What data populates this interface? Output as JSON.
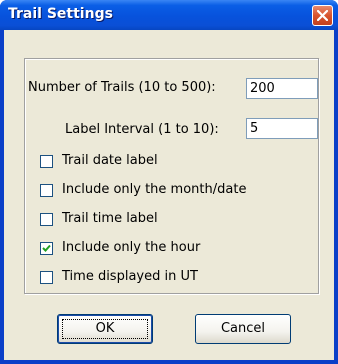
{
  "window": {
    "title": "Trail Settings"
  },
  "fields": {
    "num_trails_label": "Number of Trails (10 to 500):",
    "num_trails_value": "200",
    "label_interval_label": "Label Interval (1 to 10):",
    "label_interval_value": "5"
  },
  "options": [
    {
      "label": "Trail date label",
      "checked": false
    },
    {
      "label": "Include only the month/date",
      "checked": false
    },
    {
      "label": "Trail time label",
      "checked": false
    },
    {
      "label": "Include only the hour",
      "checked": true
    },
    {
      "label": "Time displayed in UT",
      "checked": false
    }
  ],
  "buttons": {
    "ok": "OK",
    "cancel": "Cancel"
  }
}
